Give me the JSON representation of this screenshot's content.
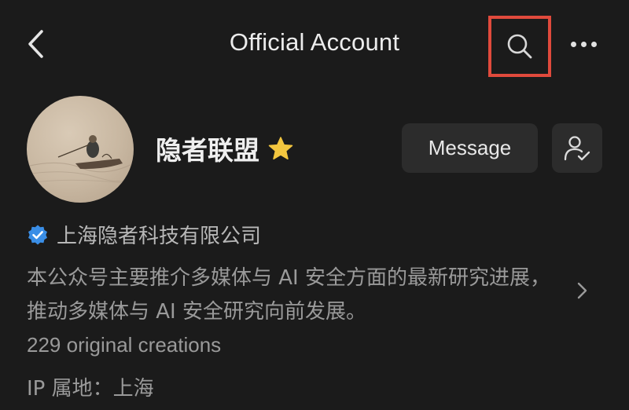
{
  "header": {
    "title": "Official Account",
    "back_icon": "chevron-left-icon",
    "search_icon": "search-icon",
    "more_icon": "more-dots-icon",
    "highlight_color": "#e04a3c"
  },
  "profile": {
    "name": "隐者联盟",
    "badge_icon": "star-icon",
    "badge_color": "#f3c63f",
    "message_label": "Message",
    "follow_icon": "person-check-icon",
    "verified_icon": "verified-badge-icon",
    "verified_color": "#3a8ee6",
    "company": "上海隐者科技有限公司",
    "description": "本公众号主要推介多媒体与 AI 安全方面的最新研究进展，推动多媒体与 AI 安全研究向前发展。",
    "creations": "229 original creations",
    "ip_location": "IP 属地：上海"
  }
}
